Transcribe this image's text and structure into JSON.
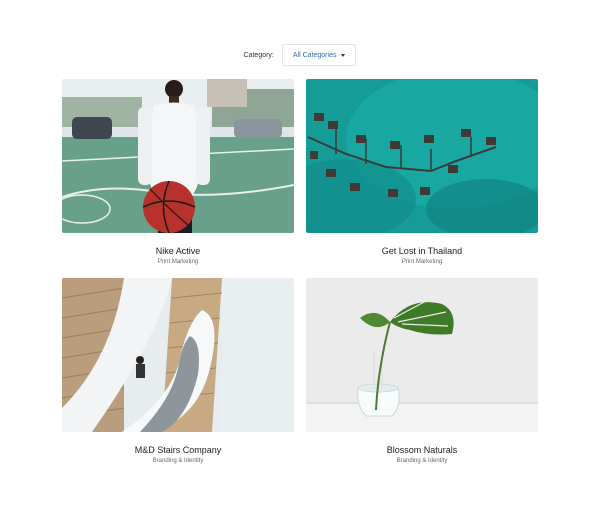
{
  "filter": {
    "label": "Category:",
    "selected": "All Categories"
  },
  "portfolio": {
    "items": [
      {
        "title": "Nike Active",
        "category": "Print Marketing"
      },
      {
        "title": "Get Lost in Thailand",
        "category": "Print Marketing"
      },
      {
        "title": "M&D Stairs Company",
        "category": "Branding & Identity"
      },
      {
        "title": "Blossom Naturals",
        "category": "Branding & Identity"
      }
    ]
  },
  "colors": {
    "accent": "#2f6db5",
    "border": "#e3e6ea"
  }
}
